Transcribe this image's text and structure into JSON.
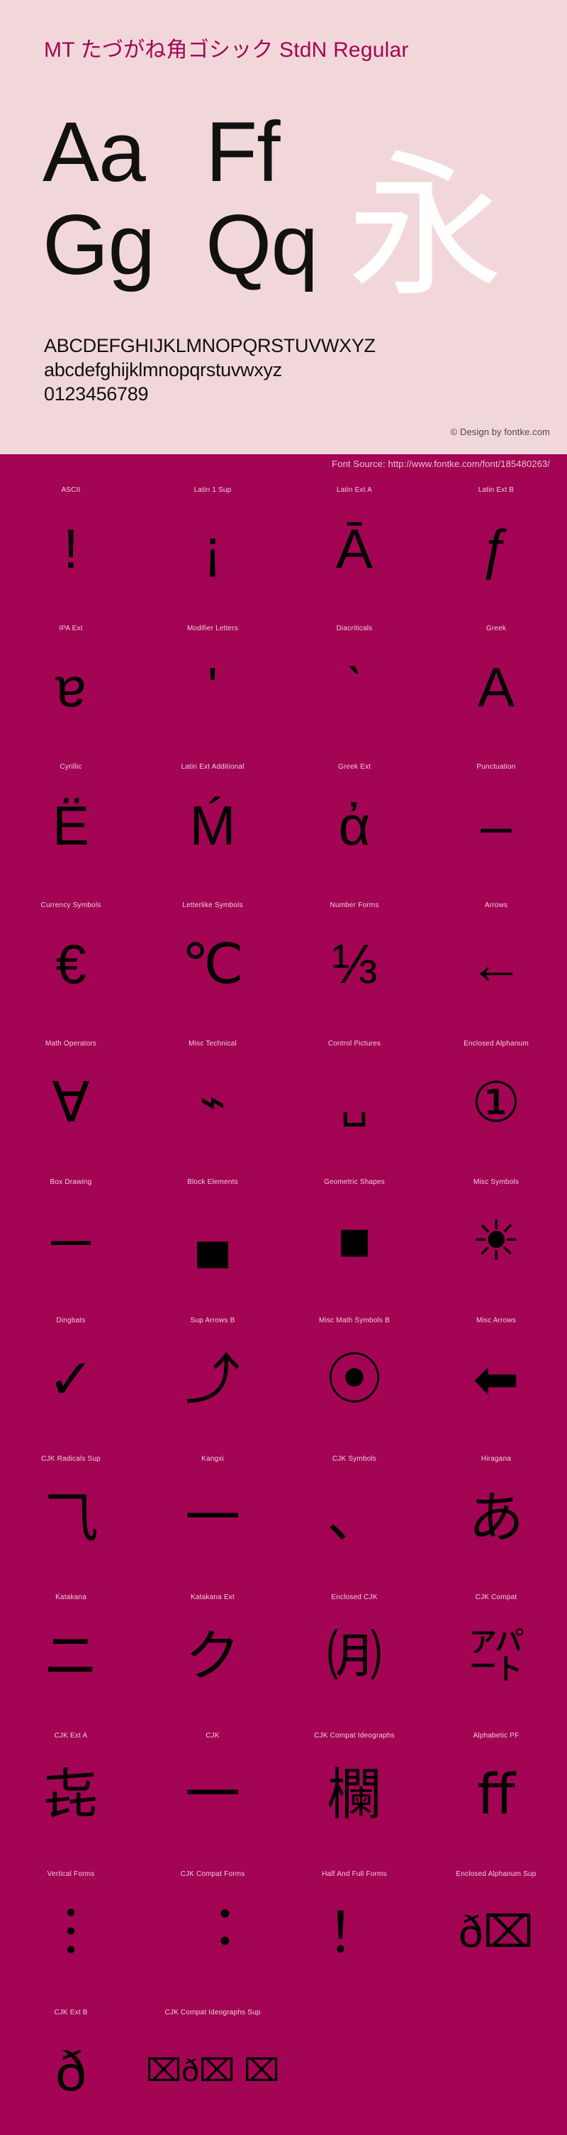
{
  "hero": {
    "title": "MT たづがね角ゴシック StdN Regular",
    "samples": [
      {
        "left": "Aa",
        "right": "Ff"
      },
      {
        "left": "Gg",
        "right": "Qq"
      }
    ],
    "cjk_sample": "永",
    "charset_lines": [
      "ABCDEFGHIJKLMNOPQRSTUVWXYZ",
      "abcdefghijklmnopqrstuvwxyz",
      "0123456789"
    ],
    "copyright": "© Design by fontke.com"
  },
  "source_bar": {
    "text": "Font Source: http://www.fontke.com/font/185480263/"
  },
  "colors": {
    "hero_background": "#f2d7da",
    "accent_magenta": "#a30454",
    "title_color": "#a30454",
    "glyph_black": "#000000",
    "cjk_white": "#ffffff",
    "label_pink": "#f0cede"
  },
  "grid": {
    "rows": [
      [
        {
          "label": "ASCII",
          "glyph": "!",
          "size": ""
        },
        {
          "label": "Latin 1 Sup",
          "glyph": "¡",
          "size": ""
        },
        {
          "label": "Latin Ext A",
          "glyph": "Ā",
          "size": ""
        },
        {
          "label": "Latin Ext B",
          "glyph": "ƒ",
          "size": ""
        }
      ],
      [
        {
          "label": "IPA Ext",
          "glyph": "ɐ",
          "size": ""
        },
        {
          "label": "Modifier Letters",
          "glyph": "ʹ",
          "size": ""
        },
        {
          "label": "Diacriticals",
          "glyph": "ˋ",
          "size": ""
        },
        {
          "label": "Greek",
          "glyph": "Α",
          "size": ""
        }
      ],
      [
        {
          "label": "Cyrillic",
          "glyph": "Ё",
          "size": ""
        },
        {
          "label": "Latin Ext Additional",
          "glyph": "Ḿ",
          "size": ""
        },
        {
          "label": "Greek Ext",
          "glyph": "ἀ",
          "size": ""
        },
        {
          "label": "Punctuation",
          "glyph": "‒",
          "size": ""
        }
      ],
      [
        {
          "label": "Currency Symbols",
          "glyph": "€",
          "size": ""
        },
        {
          "label": "Letterlike Symbols",
          "glyph": "℃",
          "size": ""
        },
        {
          "label": "Number Forms",
          "glyph": "⅓",
          "size": ""
        },
        {
          "label": "Arrows",
          "glyph": "←",
          "size": ""
        }
      ],
      [
        {
          "label": "Math Operators",
          "glyph": "∀",
          "size": ""
        },
        {
          "label": "Misc Technical",
          "glyph": "⌁",
          "size": "sm"
        },
        {
          "label": "Control Pictures",
          "glyph": "␣",
          "size": "sm"
        },
        {
          "label": "Enclosed Alphanum",
          "glyph": "①",
          "size": ""
        }
      ],
      [
        {
          "label": "Box Drawing",
          "glyph": "─",
          "size": ""
        },
        {
          "label": "Block Elements",
          "glyph": "▄",
          "size": "sm"
        },
        {
          "label": "Geometric Shapes",
          "glyph": "■",
          "size": ""
        },
        {
          "label": "Misc Symbols",
          "glyph": "☀",
          "size": ""
        }
      ],
      [
        {
          "label": "Dingbats",
          "glyph": "✓",
          "size": ""
        },
        {
          "label": "Sup Arrows B",
          "glyph": "⤴",
          "size": ""
        },
        {
          "label": "Misc Math Symbols B",
          "glyph": "⦿",
          "size": ""
        },
        {
          "label": "Misc Arrows",
          "glyph": "⬅",
          "size": ""
        }
      ],
      [
        {
          "label": "CJK Radicals Sup",
          "glyph": "⺄",
          "size": ""
        },
        {
          "label": "Kangxi",
          "glyph": "⼀",
          "size": ""
        },
        {
          "label": "CJK Symbols",
          "glyph": "、",
          "size": ""
        },
        {
          "label": "Hiragana",
          "glyph": "あ",
          "size": ""
        }
      ],
      [
        {
          "label": "Katakana",
          "glyph": "ニ",
          "size": ""
        },
        {
          "label": "Katakana Ext",
          "glyph": "ク",
          "size": ""
        },
        {
          "label": "Enclosed CJK",
          "glyph": "㈪",
          "size": ""
        },
        {
          "label": "CJK Compat",
          "glyph": "㌀",
          "size": ""
        }
      ],
      [
        {
          "label": "CJK Ext A",
          "glyph": "㐂",
          "size": ""
        },
        {
          "label": "CJK",
          "glyph": "一",
          "size": ""
        },
        {
          "label": "CJK Compat Ideographs",
          "glyph": "欄",
          "size": ""
        },
        {
          "label": "Alphabetic PF",
          "glyph": "ﬀ",
          "size": ""
        }
      ],
      [
        {
          "label": "Vertical Forms",
          "glyph": "︙",
          "size": ""
        },
        {
          "label": "CJK Compat Forms",
          "glyph": "︓",
          "size": ""
        },
        {
          "label": "Half And Full Forms",
          "glyph": "！",
          "size": ""
        },
        {
          "label": "Enclosed Alphanum Sup",
          "glyph": "ð⌧",
          "size": "sm"
        }
      ],
      [
        {
          "label": "CJK Ext B",
          "glyph": "ð",
          "size": ""
        },
        {
          "label": "CJK Compat Ideographs Sup",
          "glyph": "⌧ð⌧ ⌧",
          "size": "tiny"
        },
        {
          "label": "",
          "glyph": "",
          "size": ""
        },
        {
          "label": "",
          "glyph": "",
          "size": ""
        }
      ]
    ]
  }
}
